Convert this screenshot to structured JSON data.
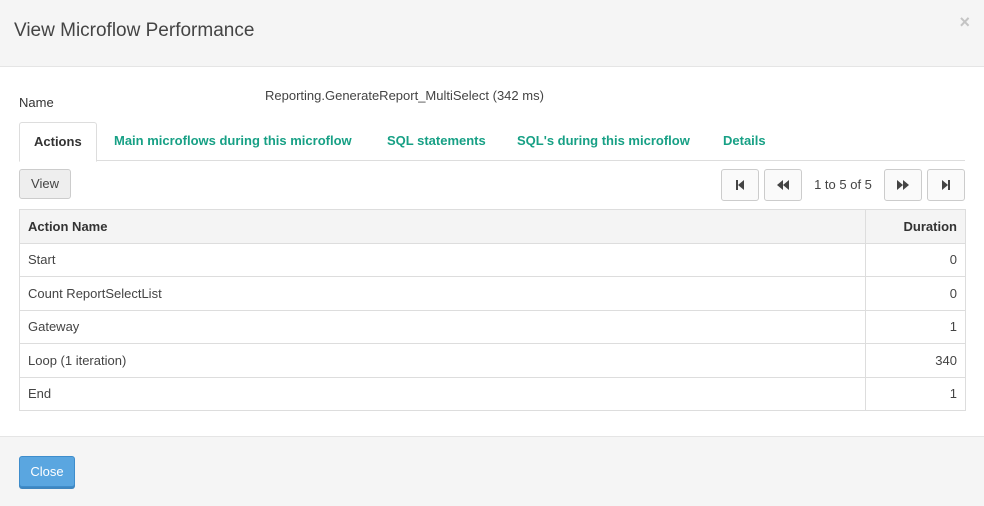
{
  "dialog": {
    "title": "View Microflow Performance",
    "close_symbol": "×"
  },
  "info": {
    "name_label": "Name",
    "name_value": "Reporting.GenerateReport_MultiSelect (342 ms)"
  },
  "tabs": [
    {
      "label": "Actions",
      "active": true
    },
    {
      "label": "Main microflows during this microflow",
      "active": false
    },
    {
      "label": "SQL statements",
      "active": false
    },
    {
      "label": "SQL's during this microflow",
      "active": false
    },
    {
      "label": "Details",
      "active": false
    }
  ],
  "toolbar": {
    "view_label": "View",
    "paging_info": "1 to 5 of 5",
    "icons": [
      "first-page-icon",
      "previous-page-icon",
      "next-page-icon",
      "last-page-icon"
    ]
  },
  "table": {
    "columns": [
      "Action Name",
      "Duration"
    ],
    "rows": [
      [
        "Start",
        "0"
      ],
      [
        "Count ReportSelectList",
        "0"
      ],
      [
        "Gateway",
        "1"
      ],
      [
        "Loop (1 iteration)",
        "340"
      ],
      [
        "End",
        "1"
      ]
    ]
  },
  "footer": {
    "close_label": "Close"
  },
  "colors": {
    "tab_link": "#17a085",
    "primary_button": "#5aa6e0"
  }
}
